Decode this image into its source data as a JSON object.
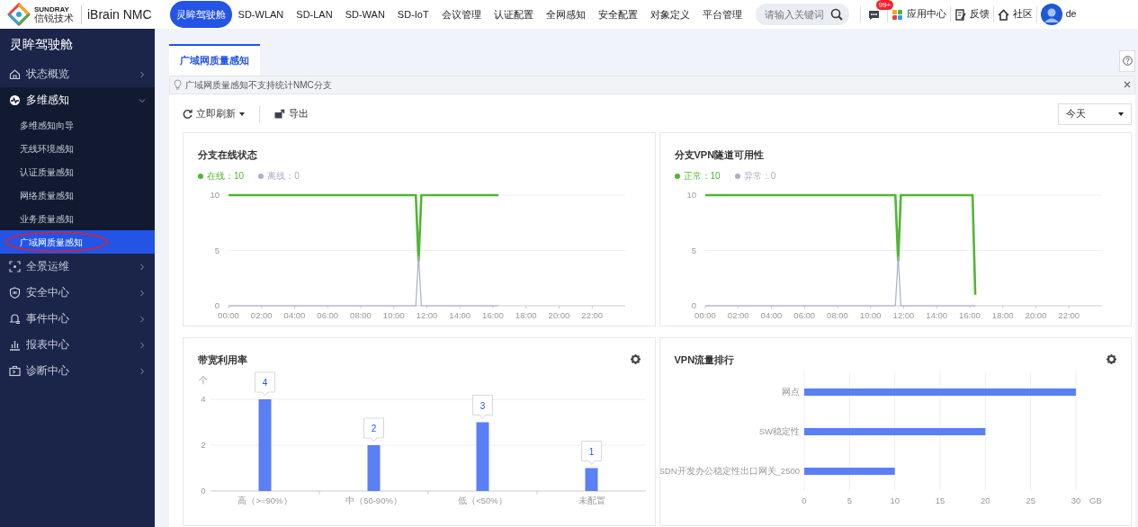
{
  "header": {
    "brand": "SUNDRAY",
    "brand_cn": "信锐技术",
    "product": "iBrain NMC"
  },
  "nav": [
    {
      "label": "灵眸驾驶舱",
      "selected": true
    },
    {
      "label": "SD-WLAN",
      "selected": false
    },
    {
      "label": "SD-LAN",
      "selected": false
    },
    {
      "label": "SD-WAN",
      "selected": false
    },
    {
      "label": "SD-IoT",
      "selected": false
    },
    {
      "label": "会议管理",
      "selected": false
    },
    {
      "label": "认证配置",
      "selected": false
    },
    {
      "label": "全网感知",
      "selected": false
    },
    {
      "label": "安全配置",
      "selected": false
    },
    {
      "label": "对象定义",
      "selected": false
    },
    {
      "label": "平台管理",
      "selected": false
    }
  ],
  "search": {
    "placeholder": "请输入关键词"
  },
  "messages": {
    "badge": "99+"
  },
  "header_links": [
    {
      "kind": "apps",
      "label": "应用中心"
    },
    {
      "kind": "feedback",
      "label": "反馈"
    },
    {
      "kind": "community",
      "label": "社区"
    }
  ],
  "user": {
    "name": "de"
  },
  "sidebar": {
    "title": "灵眸驾驶舱",
    "items": [
      {
        "kind": "home",
        "label": "状态概览",
        "expanded": false
      },
      {
        "kind": "pulse",
        "label": "多维感知",
        "expanded": true,
        "children": [
          {
            "label": "多维感知向导",
            "selected": false
          },
          {
            "label": "无线环境感知",
            "selected": false
          },
          {
            "label": "认证质量感知",
            "selected": false
          },
          {
            "label": "网络质量感知",
            "selected": false
          },
          {
            "label": "业务质量感知",
            "selected": false
          },
          {
            "label": "广域网质量感知",
            "selected": true,
            "circled": true
          }
        ]
      },
      {
        "kind": "scan",
        "label": "全景运维",
        "expanded": false
      },
      {
        "kind": "shield",
        "label": "安全中心",
        "expanded": false
      },
      {
        "kind": "bell",
        "label": "事件中心",
        "expanded": false
      },
      {
        "kind": "report",
        "label": "报表中心",
        "expanded": false
      },
      {
        "kind": "diagnose",
        "label": "诊断中心",
        "expanded": false
      }
    ]
  },
  "page_tabs": [
    {
      "label": "广域网质量感知",
      "selected": true
    }
  ],
  "notice": "广域网质量感知不支持统计NMC分支",
  "toolbar": {
    "refresh": "立即刷新",
    "export": "导出",
    "range": "今天"
  },
  "panels": [
    {
      "title": "分支在线状态",
      "legend": [
        {
          "label": "在线：10",
          "color": "#52b534"
        },
        {
          "label": "离线：0",
          "color": "#a9b0c3"
        }
      ],
      "chart_data": {
        "type": "line",
        "x": [
          0,
          11.33,
          11.5,
          11.67,
          16.33
        ],
        "xlim": [
          0,
          24
        ],
        "ylim": [
          0,
          10
        ],
        "xticks": [
          {
            "value": 0,
            "label": "00:00"
          },
          {
            "value": 2,
            "label": "02:00"
          },
          {
            "value": 4,
            "label": "04:00"
          },
          {
            "value": 6,
            "label": "06:00"
          },
          {
            "value": 8,
            "label": "08:00"
          },
          {
            "value": 10,
            "label": "10:00"
          },
          {
            "value": 12,
            "label": "12:00"
          },
          {
            "value": 14,
            "label": "14:00"
          },
          {
            "value": 16,
            "label": "16:00"
          },
          {
            "value": 18,
            "label": "18:00"
          },
          {
            "value": 20,
            "label": "20:00"
          },
          {
            "value": 22,
            "label": "22:00"
          }
        ],
        "yticks": [
          0,
          5,
          10
        ],
        "series": [
          {
            "color": "#52b534",
            "values": [
              10,
              10,
              4,
              10,
              10
            ]
          },
          {
            "color": "#a9b0c3",
            "values": [
              0,
              0,
              4.5,
              0,
              0
            ]
          }
        ]
      }
    },
    {
      "title": "分支VPN隧道可用性",
      "legend": [
        {
          "label": "正常：10",
          "color": "#52b534"
        },
        {
          "label": "异常：0",
          "color": "#a9b0c3"
        }
      ],
      "chart_data": {
        "type": "line",
        "x": [
          0,
          11.5,
          11.67,
          11.83,
          16.17,
          16.33
        ],
        "xlim": [
          0,
          24
        ],
        "ylim": [
          0,
          10
        ],
        "xticks": [
          {
            "value": 0,
            "label": "00:00"
          },
          {
            "value": 2,
            "label": "02:00"
          },
          {
            "value": 4,
            "label": "04:00"
          },
          {
            "value": 6,
            "label": "06:00"
          },
          {
            "value": 8,
            "label": "08:00"
          },
          {
            "value": 10,
            "label": "10:00"
          },
          {
            "value": 12,
            "label": "12:00"
          },
          {
            "value": 14,
            "label": "14:00"
          },
          {
            "value": 16,
            "label": "16:00"
          },
          {
            "value": 18,
            "label": "18:00"
          },
          {
            "value": 20,
            "label": "20:00"
          },
          {
            "value": 22,
            "label": "22:00"
          }
        ],
        "yticks": [
          0,
          5,
          10
        ],
        "series": [
          {
            "color": "#52b534",
            "values": [
              10,
              10,
              4,
              10,
              10,
              1
            ]
          },
          {
            "color": "#a9b0c3",
            "values": [
              0,
              0,
              4.5,
              0,
              0,
              0
            ]
          }
        ]
      }
    },
    {
      "title": "带宽利用率",
      "settings_button": true,
      "chart_data": {
        "type": "bar",
        "orientation": "vertical",
        "ylabel": "个",
        "categories": [
          "高（>=90%）",
          "中（50-90%）",
          "低（<50%）",
          "未配置"
        ],
        "ylim": [
          0,
          4
        ],
        "yticks": [
          0,
          2,
          4
        ],
        "data_labels": true,
        "series": [
          {
            "color": "#5b7ff5",
            "values": [
              4,
              2,
              3,
              1
            ]
          }
        ]
      }
    },
    {
      "title": "VPN流量排行",
      "settings_button": true,
      "chart_data": {
        "type": "bar",
        "orientation": "horizontal",
        "xlabel": "GB",
        "categories": [
          "网点",
          "SW稳定性",
          "SDN开发办公稳定性出口网关_2500"
        ],
        "xlim": [
          0,
          30
        ],
        "grid": true,
        "xticks": [
          0,
          5,
          10,
          15,
          20,
          25,
          30
        ],
        "series": [
          {
            "color": "#5b7ff5",
            "values": [
              30,
              20,
              10
            ]
          }
        ]
      }
    }
  ]
}
